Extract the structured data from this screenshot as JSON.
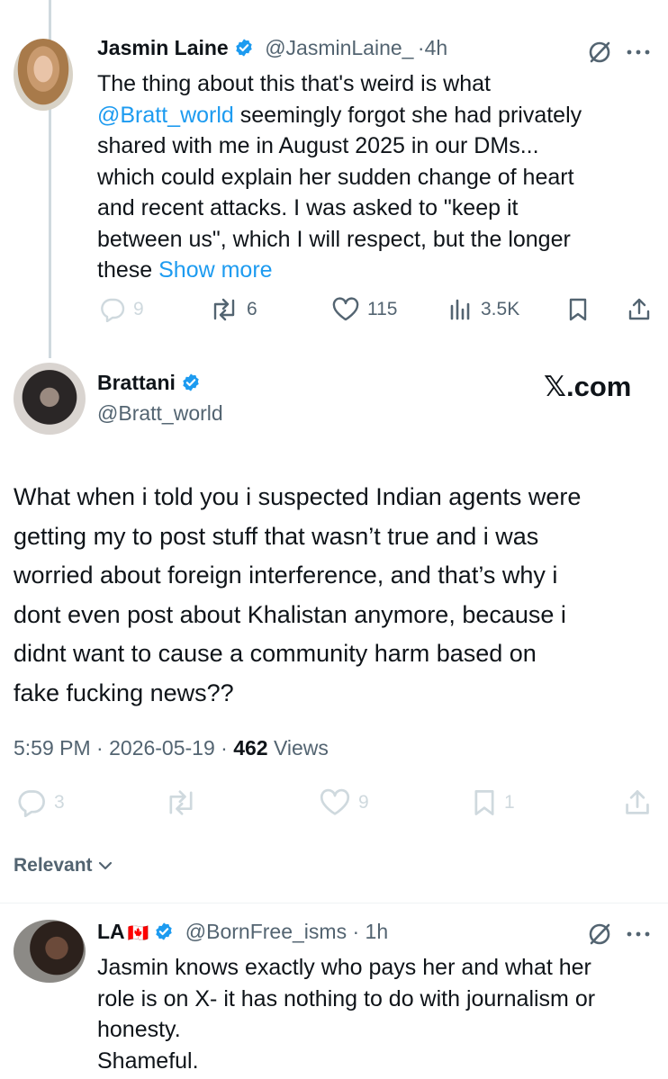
{
  "tweet1": {
    "name": "Jasmin Laine",
    "handle": "@JasminLaine_",
    "sep": "·",
    "time": "4h",
    "line1": "The thing about this that's weird is what",
    "mention": "@Bratt_world",
    "line2_rest": " seemingly forgot she had privately",
    "line3": "shared with me in August 2025 in our DMs...",
    "line4": "which could explain her sudden change of heart",
    "line5": "and recent attacks. I was asked to \"keep it",
    "line6": "between us\", which I will respect, but the longer",
    "line7_start": "these ",
    "show_more": "Show more",
    "replies": "9",
    "reposts": "6",
    "likes": "115",
    "views": "3.5K"
  },
  "quoted": {
    "name": "Brattani",
    "handle": "@Bratt_world",
    "watermark": "𝕏.com",
    "line1": "What when i told you i suspected Indian agents were",
    "line2": "getting my to post stuff that wasn’t true and i was",
    "line3": "worried about foreign interference, and that’s why i",
    "line4": "dont even post about Khalistan anymore, because i",
    "line5": "didnt want to cause a community harm based on",
    "line6": "fake fucking news??",
    "time": "5:59 PM",
    "date": "2026-05-19",
    "views_count": "462",
    "views_label": " Views",
    "replies": "3",
    "likes": "9",
    "bookmarks": "1"
  },
  "filter": {
    "label": "Relevant"
  },
  "tweet2": {
    "name": "LA",
    "flag": "🇨🇦",
    "handle": "@BornFree_isms",
    "time": "1h",
    "line1": "Jasmin knows exactly who pays her and what her",
    "line2": "role is on X-  it has nothing to do with journalism or",
    "line3": "honesty.",
    "line4": "Shameful."
  },
  "colors": {
    "accent": "#1d9bf0",
    "text": "#0f1419",
    "muted": "#536471",
    "faded": "#cfd9de"
  }
}
